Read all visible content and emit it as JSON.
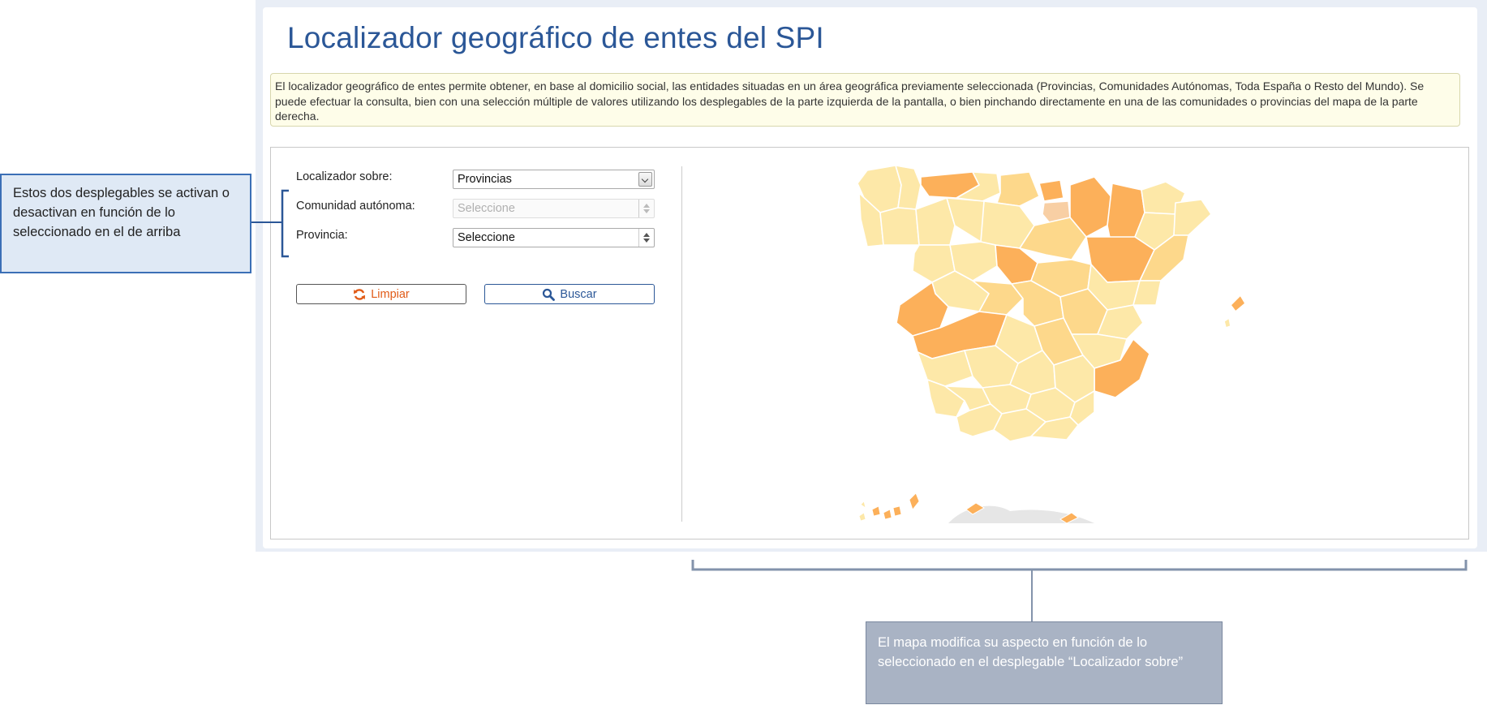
{
  "header": {
    "title": "Localizador geográfico de entes del SPI"
  },
  "info": {
    "text": "El localizador geográfico de entes permite obtener, en base al domicilio social, las entidades situadas en un área geográfica previamente seleccionada (Provincias, Comunidades Autónomas, Toda España o Resto del Mundo). Se puede efectuar la consulta, bien con una selección múltiple de valores utilizando los desplegables de la parte izquierda de la pantalla, o bien pinchando directamente en una de las comunidades o provincias del mapa de la parte derecha."
  },
  "form": {
    "localizador": {
      "label": "Localizador sobre:",
      "value": "Provincias"
    },
    "comunidad": {
      "label": "Comunidad autónoma:",
      "value": "Seleccione",
      "disabled": true
    },
    "provincia": {
      "label": "Provincia:",
      "value": "Seleccione"
    },
    "clear_label": "Limpiar",
    "search_label": "Buscar"
  },
  "map": {
    "colors": {
      "light": "#fde8a8",
      "medium": "#fdd88b",
      "dark": "#fcb05a",
      "highlight": "#f8cfa4",
      "border": "#ffffff",
      "morocco": "#e6e6e6"
    }
  },
  "annotations": {
    "left": "Estos dos desplegables se activan o desactivan en función de lo seleccionado en el de arriba",
    "bottom": "El mapa modifica su aspecto en función de lo seleccionado en el desplegable “Localizador sobre”"
  },
  "icons": {
    "clear": "refresh-icon",
    "search": "search-icon",
    "dropdown": "chevron-down-icon"
  },
  "theme": {
    "title_color": "#2b5797",
    "clear_color": "#e15b17",
    "bracket_color": "#2b5797"
  }
}
